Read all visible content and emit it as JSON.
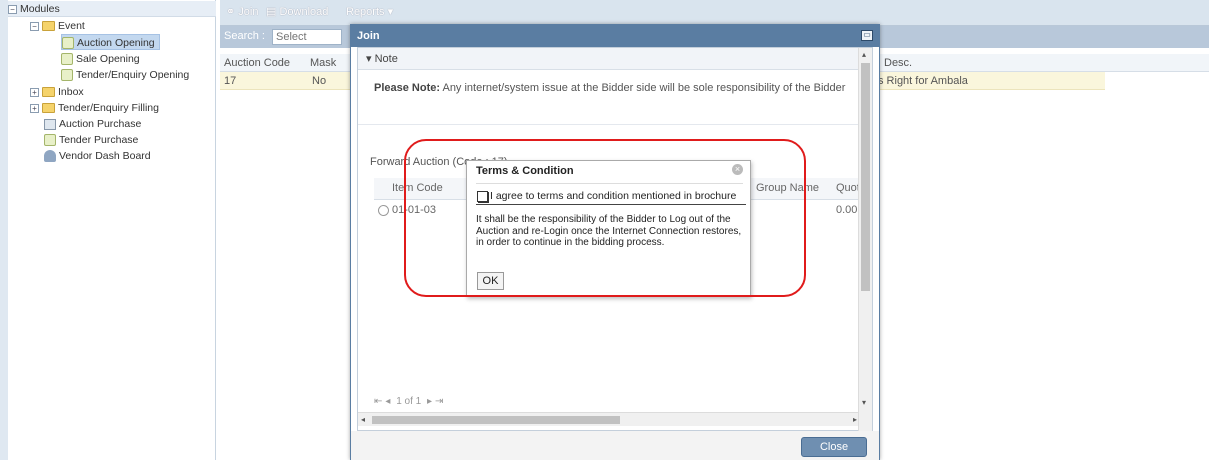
{
  "tree": {
    "modules": "Modules",
    "event": "Event",
    "auction_opening": "Auction Opening",
    "sale_opening": "Sale Opening",
    "tender_opening": "Tender/Enquiry Opening",
    "inbox": "Inbox",
    "tender_filling": "Tender/Enquiry Filling",
    "auction_purchase": "Auction Purchase",
    "tender_purchase": "Tender Purchase",
    "vendor_dash": "Vendor Dash Board"
  },
  "toolbar": {
    "join": "Join",
    "download": "Download",
    "reports": "Reports"
  },
  "search": {
    "label": "Search :",
    "placeholder": "Select"
  },
  "grid": {
    "headers": {
      "auction_code": "Auction Code",
      "mask": "Mask",
      "desc": "Desc."
    },
    "row": {
      "auction_code": "17",
      "mask": "No",
      "desc": "s Right for Ambala"
    }
  },
  "dialog": {
    "title": "Join",
    "note_header": "Note",
    "note_bold": "Please Note:",
    "note_text": " Any internet/system issue at the Bidder side will be sole responsibility of the Bidder",
    "forward_title": "Forward Auction (Code : 17)",
    "items_headers": {
      "item_code": "Item Code",
      "group_name": "Group Name",
      "quot": "Quot"
    },
    "items_row": {
      "item_code": "01-01-03",
      "quot": "0.00"
    },
    "pager": "1 of 1",
    "close_label": "Close"
  },
  "terms": {
    "title": "Terms & Condition",
    "agree_label": "I agree to terms and condition mentioned in brochure",
    "text": "It shall be the responsibility of the Bidder to Log out of the Auction and re-Login once the Internet Connection restores, in order to continue in the bidding process.",
    "ok_label": "OK"
  },
  "colors": {
    "highlight": "#e01b1b",
    "dialog_header": "#5a7da2",
    "selected_row": "#faf6dc"
  }
}
